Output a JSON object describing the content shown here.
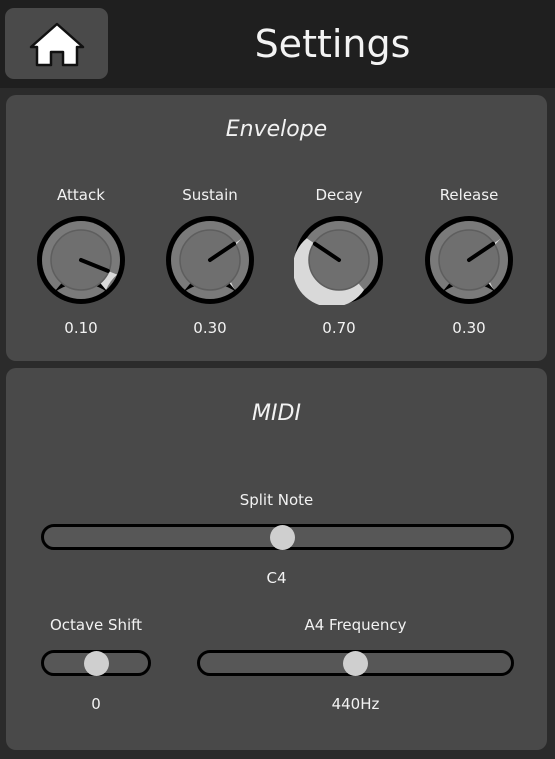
{
  "header": {
    "title": "Settings",
    "home_icon": "home-icon"
  },
  "envelope": {
    "title": "Envelope",
    "knobs": [
      {
        "label": "Attack",
        "value": "0.10",
        "level": 0.1
      },
      {
        "label": "Sustain",
        "value": "0.30",
        "level": 0.3
      },
      {
        "label": "Decay",
        "value": "0.70",
        "level": 0.7
      },
      {
        "label": "Release",
        "value": "0.30",
        "level": 0.3
      }
    ]
  },
  "midi": {
    "title": "MIDI",
    "split_note": {
      "label": "Split Note",
      "value": "C4",
      "level": 0.51
    },
    "octave_shift": {
      "label": "Octave Shift",
      "value": "0",
      "level": 0.5
    },
    "a4_frequency": {
      "label": "A4 Frequency",
      "value": "440Hz",
      "level": 0.5
    }
  },
  "colors": {
    "background": "#2b2b2b",
    "panel": "#494949",
    "knob_fill": "#d9d9d9",
    "thumb": "#cfcfcf"
  }
}
